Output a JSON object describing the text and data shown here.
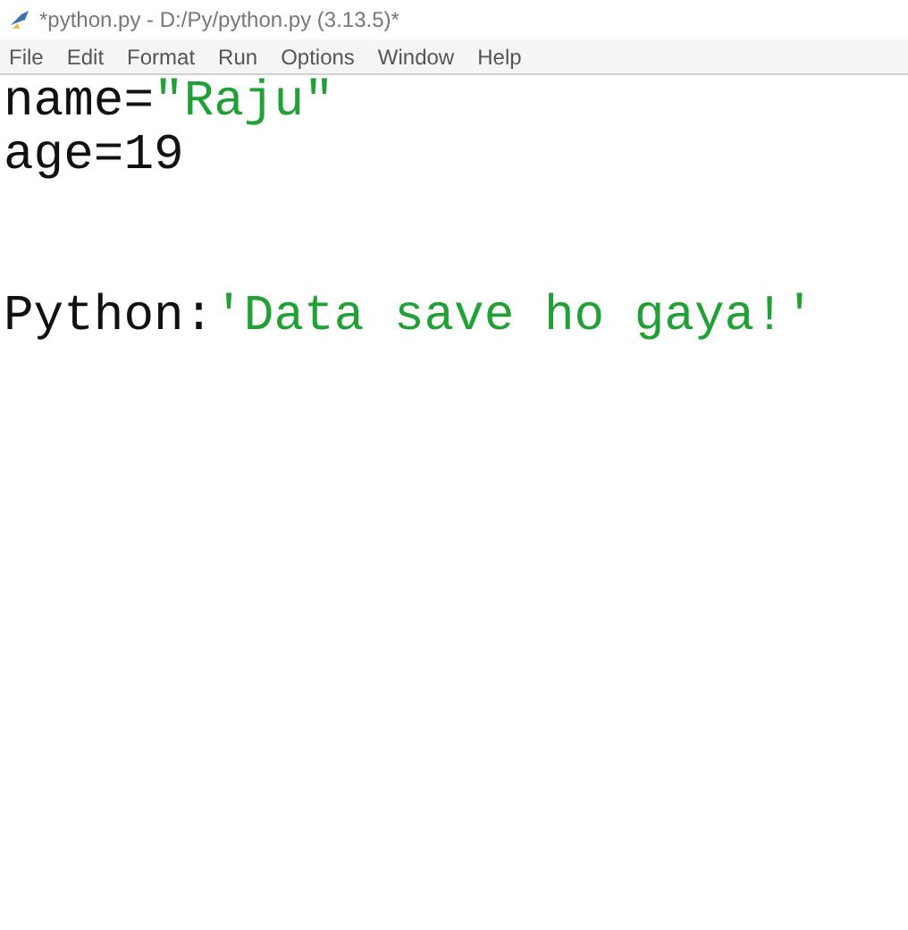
{
  "window": {
    "title": "*python.py - D:/Py/python.py (3.13.5)*"
  },
  "menu": [
    "File",
    "Edit",
    "Format",
    "Run",
    "Options",
    "Window",
    "Help"
  ],
  "editor": {
    "lines": [
      {
        "kind": "code",
        "tokens": [
          {
            "kind": "plain",
            "text": "name="
          },
          {
            "kind": "string",
            "text": "\"Raju\""
          }
        ]
      },
      {
        "kind": "code",
        "tokens": [
          {
            "kind": "plain",
            "text": "age=19"
          }
        ]
      },
      {
        "kind": "blank"
      },
      {
        "kind": "blank"
      },
      {
        "kind": "code",
        "tokens": [
          {
            "kind": "plain",
            "text": "Python:"
          },
          {
            "kind": "string",
            "text": "'Data save ho gaya!'"
          }
        ]
      }
    ]
  }
}
